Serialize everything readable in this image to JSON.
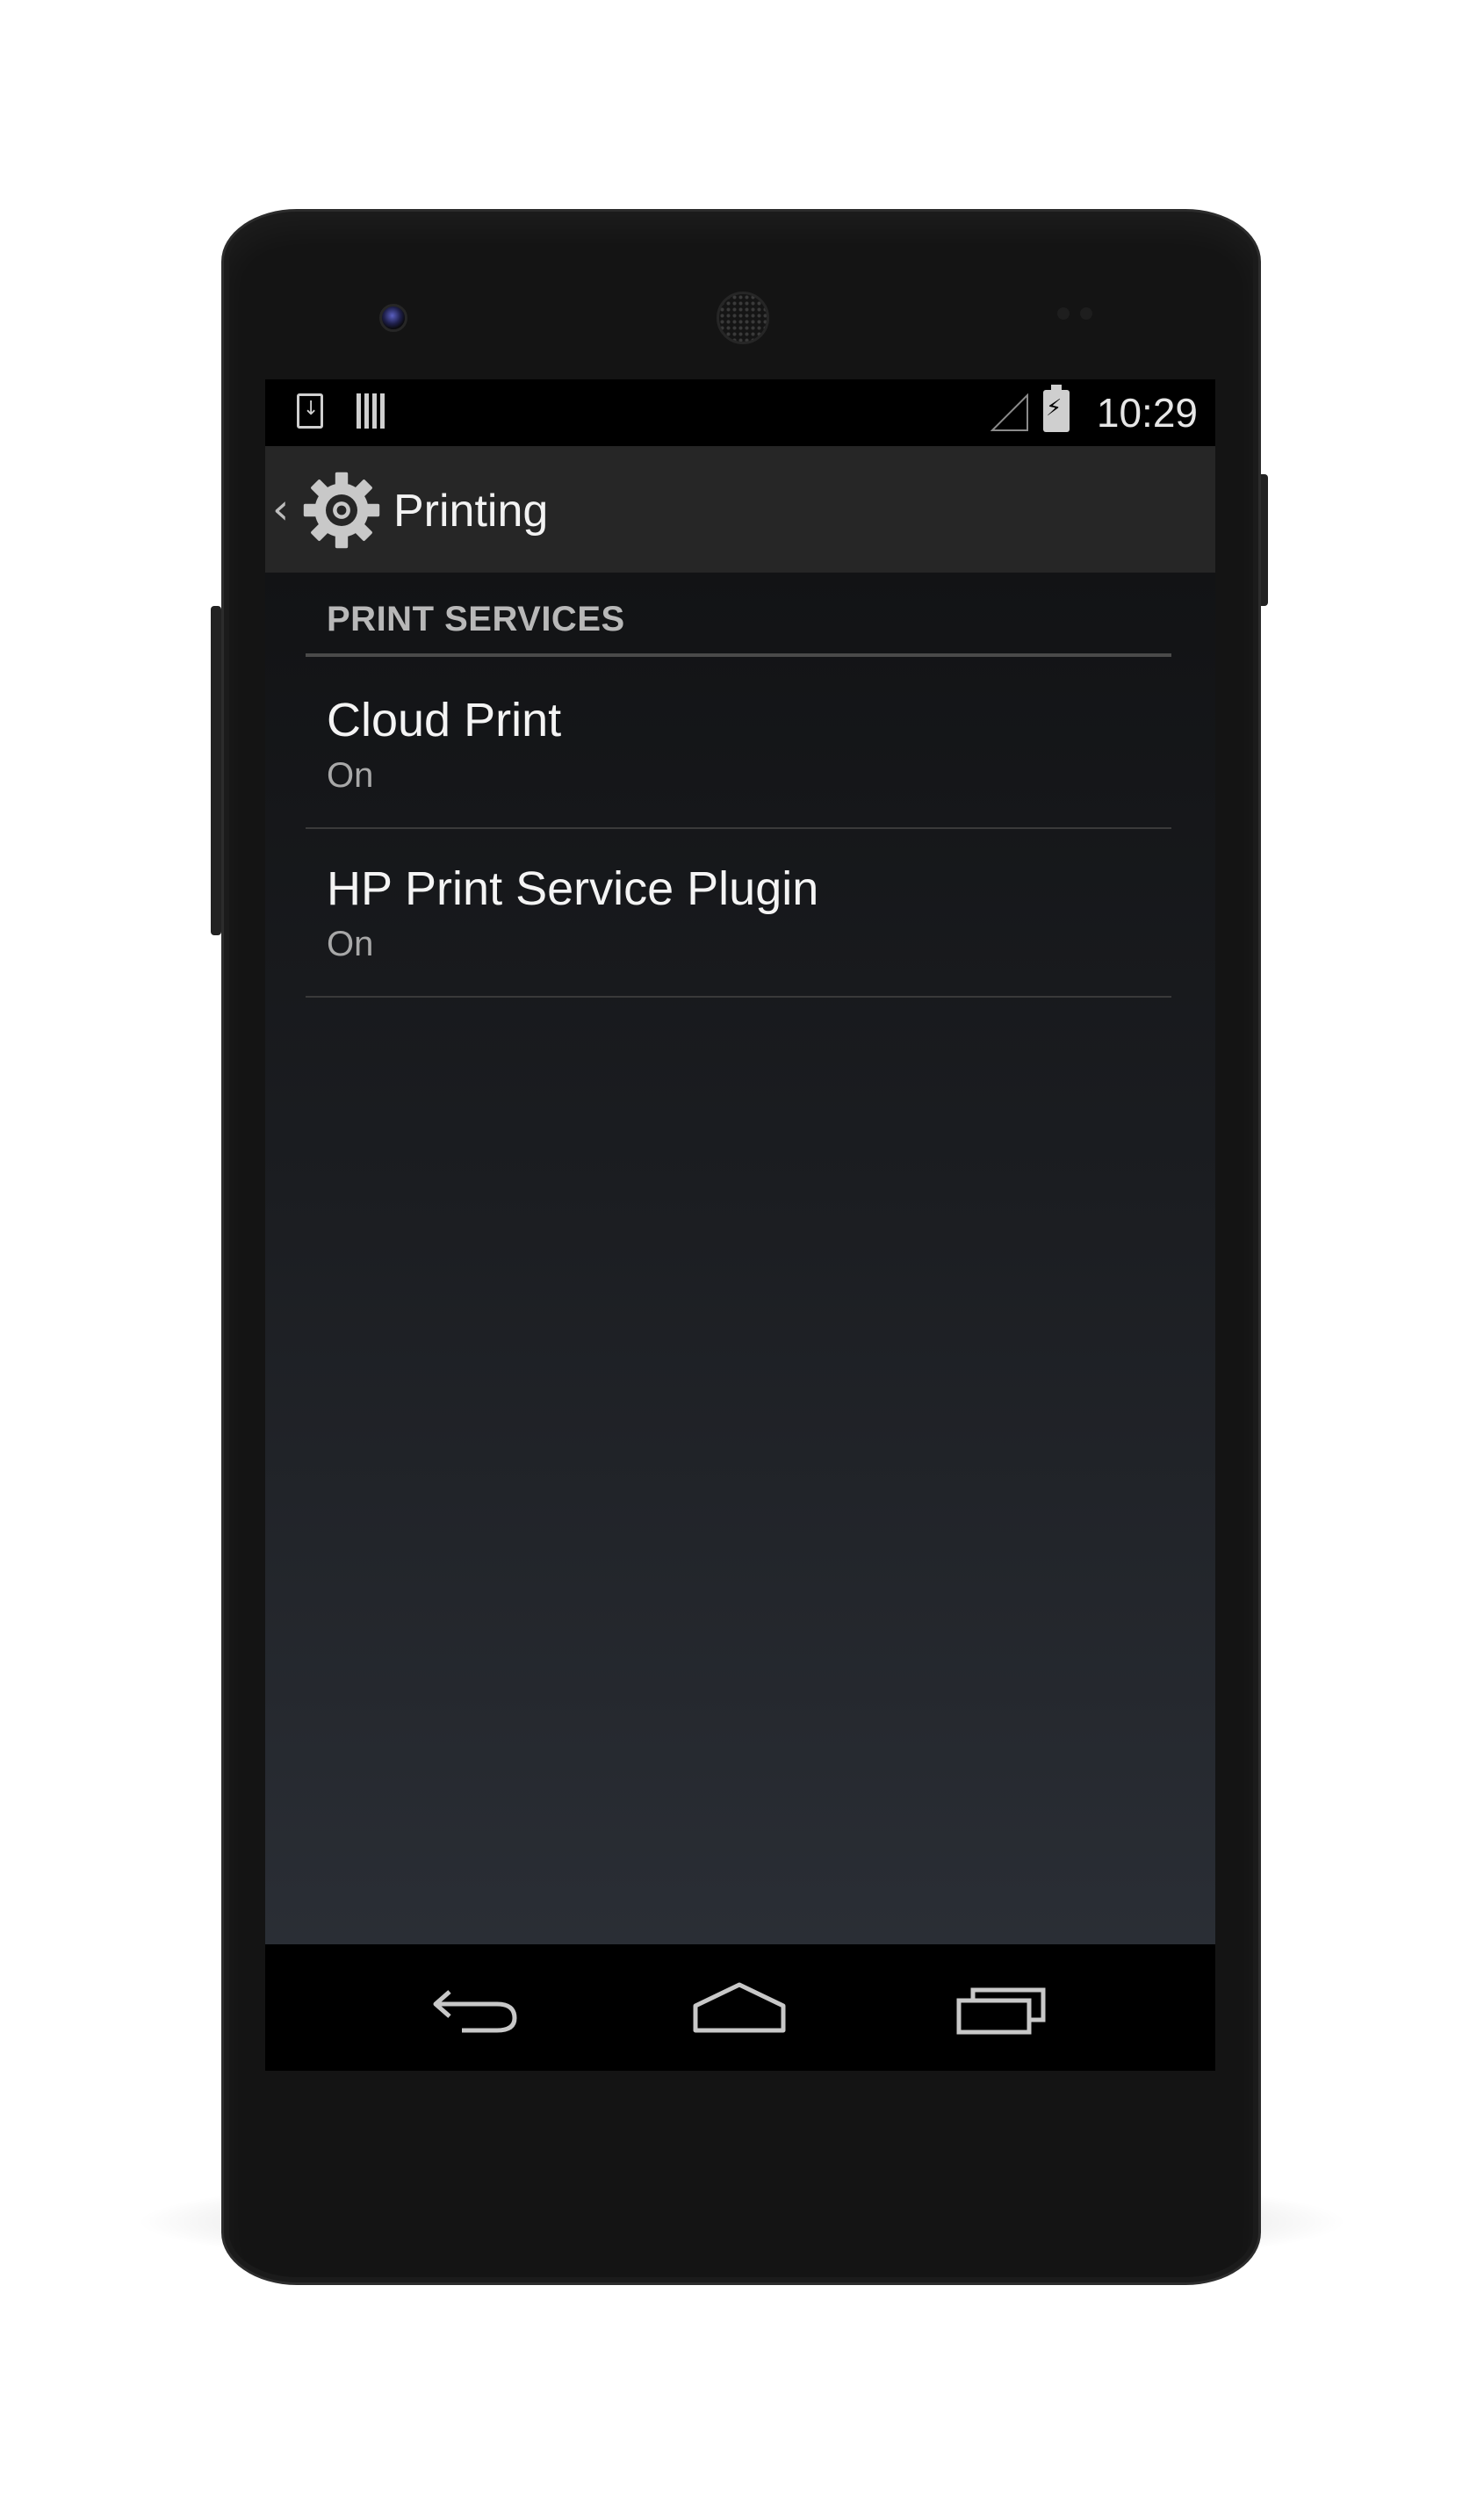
{
  "device": {
    "frame_color": "#141414",
    "icons": [
      "front-camera",
      "earpiece-speaker",
      "proximity-sensors",
      "power-button",
      "volume-rocker"
    ]
  },
  "status_bar": {
    "notification_icons": [
      "download-icon",
      "barcode-icon"
    ],
    "system_icons": [
      "signal-icon",
      "battery-charging-icon"
    ],
    "time": "10:29"
  },
  "action_bar": {
    "back_icon": "chevron-left-icon",
    "app_icon": "settings-gear-icon",
    "title": "Printing"
  },
  "settings": {
    "section_header": "PRINT SERVICES",
    "items": [
      {
        "title": "Cloud Print",
        "summary": "On"
      },
      {
        "title": "HP Print Service Plugin",
        "summary": "On"
      }
    ]
  },
  "nav_bar": {
    "buttons": [
      "back-icon",
      "home-icon",
      "recents-icon"
    ]
  },
  "colors": {
    "accent": "#33b5e5",
    "text_primary": "#f4f4f4",
    "text_secondary": "#a8a8a8",
    "header_text": "#b8b8b8"
  }
}
